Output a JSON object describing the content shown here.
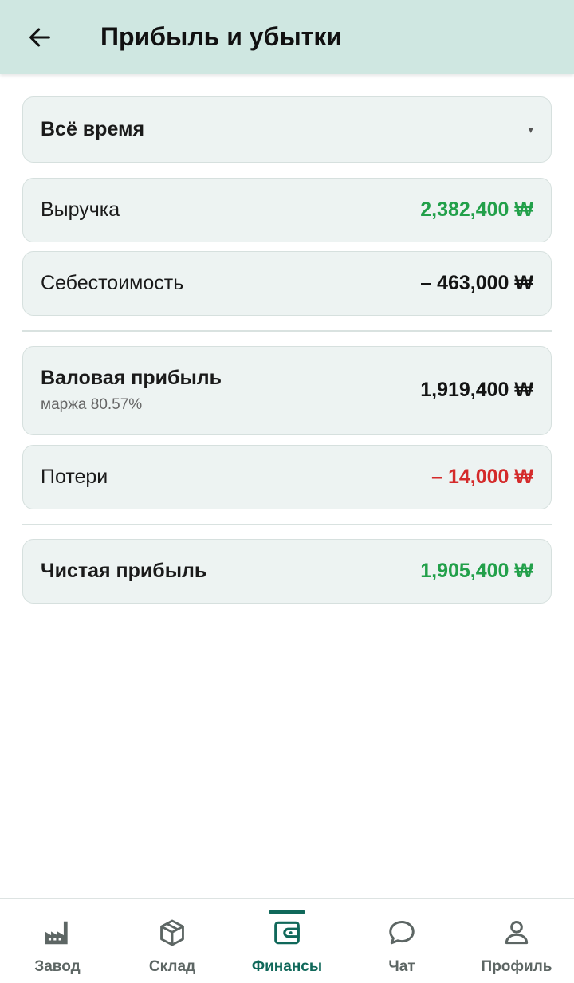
{
  "header": {
    "title": "Прибыль и убытки",
    "back_icon": "arrow-left-icon"
  },
  "period": {
    "selected": "Всё время",
    "icon": "caret-down-icon",
    "caret": "▾"
  },
  "rows": {
    "revenue": {
      "label": "Выручка",
      "value": "2,382,400 ₩",
      "color": "#22a04a"
    },
    "cost": {
      "label": "Себестоимость",
      "value": "– 463,000 ₩",
      "color": "#141414"
    },
    "gross": {
      "label": "Валовая прибыль",
      "sublabel": "маржа 80.57%",
      "value": "1,919,400 ₩",
      "color": "#141414"
    },
    "losses": {
      "label": "Потери",
      "value": "– 14,000 ₩",
      "color": "#d42a2a"
    },
    "net": {
      "label": "Чистая прибыль",
      "value": "1,905,400 ₩",
      "color": "#22a04a"
    }
  },
  "nav": {
    "active_color": "#10685a",
    "items": [
      {
        "label": "Завод",
        "icon": "factory-icon"
      },
      {
        "label": "Склад",
        "icon": "box-icon"
      },
      {
        "label": "Финансы",
        "icon": "wallet-icon",
        "active": true
      },
      {
        "label": "Чат",
        "icon": "chat-bubble-icon"
      },
      {
        "label": "Профиль",
        "icon": "person-icon"
      }
    ]
  }
}
